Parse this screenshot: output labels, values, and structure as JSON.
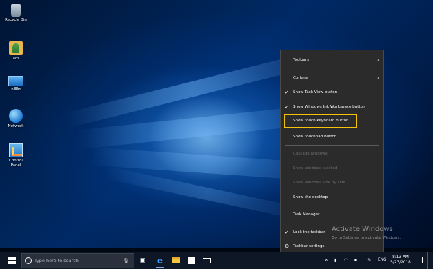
{
  "desktop": {
    "icons": [
      {
        "label": "Recycle Bin"
      },
      {
        "label": "am"
      },
      {
        "label": "This PC"
      },
      {
        "label": "Network"
      },
      {
        "label": "Control Panel"
      }
    ]
  },
  "context_menu": {
    "items": [
      {
        "label": "Toolbars",
        "submenu": true
      },
      {
        "label": "Cortana",
        "submenu": true
      },
      {
        "label": "Show Task View button",
        "checked": true
      },
      {
        "label": "Show Windows Ink Workspace button",
        "checked": true
      },
      {
        "label": "Show touch keyboard button",
        "highlighted": true
      },
      {
        "label": "Show touchpad button"
      },
      {
        "label": "Cascade windows",
        "disabled": true
      },
      {
        "label": "Show windows stacked",
        "disabled": true
      },
      {
        "label": "Show windows side by side",
        "disabled": true
      },
      {
        "label": "Show the desktop"
      },
      {
        "label": "Task Manager"
      },
      {
        "label": "Lock the taskbar",
        "checked": true
      },
      {
        "label": "Taskbar settings",
        "icon": "gear-icon"
      }
    ],
    "chevron": "›",
    "check": "✓",
    "gear": "⚙"
  },
  "watermark": {
    "title": "Activate Windows",
    "subtitle": "Go to Settings to activate Windows."
  },
  "taskbar": {
    "search_placeholder": "Type here to search",
    "tray": {
      "language": "ENG"
    },
    "clock": {
      "time": "8:13 AM",
      "date": "5/23/2018"
    }
  },
  "colors": {
    "highlight_border": "#f3c20b",
    "menu_bg": "#2b2b2b",
    "taskbar_bg": "#0e1726"
  }
}
